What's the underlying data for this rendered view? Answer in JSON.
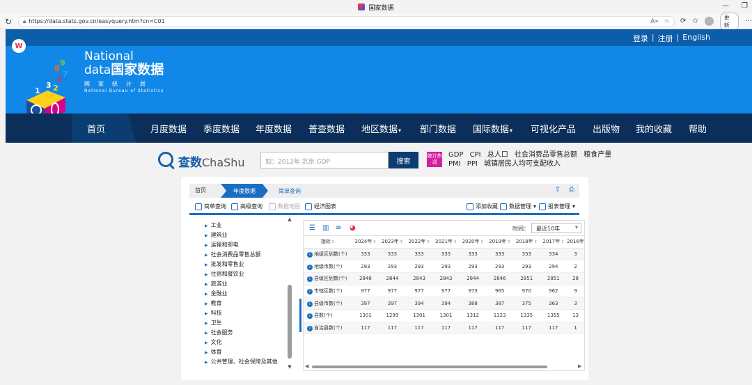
{
  "browser": {
    "window_title": "国家数据",
    "url": "https://data.stats.gov.cn/easyquery.htm?cn=C01",
    "update_label": "更新"
  },
  "header": {
    "login": "登录",
    "register": "注册",
    "english": "English",
    "sep": "|",
    "brand_en1": "National",
    "brand_en2": "data",
    "brand_cn": "国家数据",
    "bureau_cn": "国家统计局",
    "bureau_en": "National Bureau of Statistics",
    "logo_digits": [
      "9",
      "8",
      "7",
      "5",
      "1",
      "2",
      "3"
    ]
  },
  "nav": {
    "items": [
      "首页",
      "月度数据",
      "季度数据",
      "年度数据",
      "普查数据",
      "地区数据",
      "部门数据",
      "国际数据",
      "可视化产品",
      "出版物",
      "我的收藏",
      "帮助"
    ]
  },
  "search": {
    "brand_cn": "查数",
    "brand_en": "ChaShu",
    "placeholder": "如：2012年 北京 GDP",
    "button": "搜索",
    "hot_badge": "统计热词",
    "hot_line1": [
      "GDP",
      "CPI",
      "总人口",
      "社会消费品零售总额",
      "粮食产量"
    ],
    "hot_line2": [
      "PMI",
      "PPI",
      "城镇居民人均可支配收入"
    ]
  },
  "panel": {
    "crumb_home": "首页",
    "crumb_year": "年度数据",
    "crumb_query": "简单查询",
    "tools": {
      "simple_query": "简单查询",
      "advanced_query": "高级查询",
      "data_map": "数据地图",
      "econ_chart": "经济图表",
      "add_fav": "添加收藏",
      "data_mgmt": "数据管理",
      "report_mgmt": "报表管理"
    },
    "tree": [
      "工业",
      "建筑业",
      "运输和邮电",
      "社会消费品零售总额",
      "批发和零售业",
      "住宿和餐饮业",
      "旅游业",
      "金融业",
      "教育",
      "科技",
      "卫生",
      "社会服务",
      "文化",
      "体育",
      "公共管理、社会保障及其他"
    ],
    "time_label": "时间：",
    "time_value": "最近10年",
    "table": {
      "headers": [
        "指标",
        "2024年",
        "2023年",
        "2022年",
        "2021年",
        "2020年",
        "2019年",
        "2018年",
        "2017年",
        "2016年"
      ],
      "rows": [
        [
          "地级区划数(个)",
          "333",
          "333",
          "333",
          "333",
          "333",
          "333",
          "333",
          "334",
          "3"
        ],
        [
          "地级市数(个)",
          "293",
          "293",
          "293",
          "293",
          "293",
          "293",
          "293",
          "294",
          "2"
        ],
        [
          "县级区划数(个)",
          "2846",
          "2844",
          "2843",
          "2843",
          "2844",
          "2846",
          "2851",
          "2851",
          "28"
        ],
        [
          "市辖区数(个)",
          "977",
          "977",
          "977",
          "977",
          "973",
          "965",
          "970",
          "962",
          "9"
        ],
        [
          "县级市数(个)",
          "397",
          "397",
          "394",
          "394",
          "388",
          "387",
          "375",
          "363",
          "3"
        ],
        [
          "县数(个)",
          "1301",
          "1299",
          "1301",
          "1301",
          "1312",
          "1323",
          "1335",
          "1355",
          "13"
        ],
        [
          "自治县数(个)",
          "117",
          "117",
          "117",
          "117",
          "117",
          "117",
          "117",
          "117",
          "1"
        ]
      ]
    }
  }
}
